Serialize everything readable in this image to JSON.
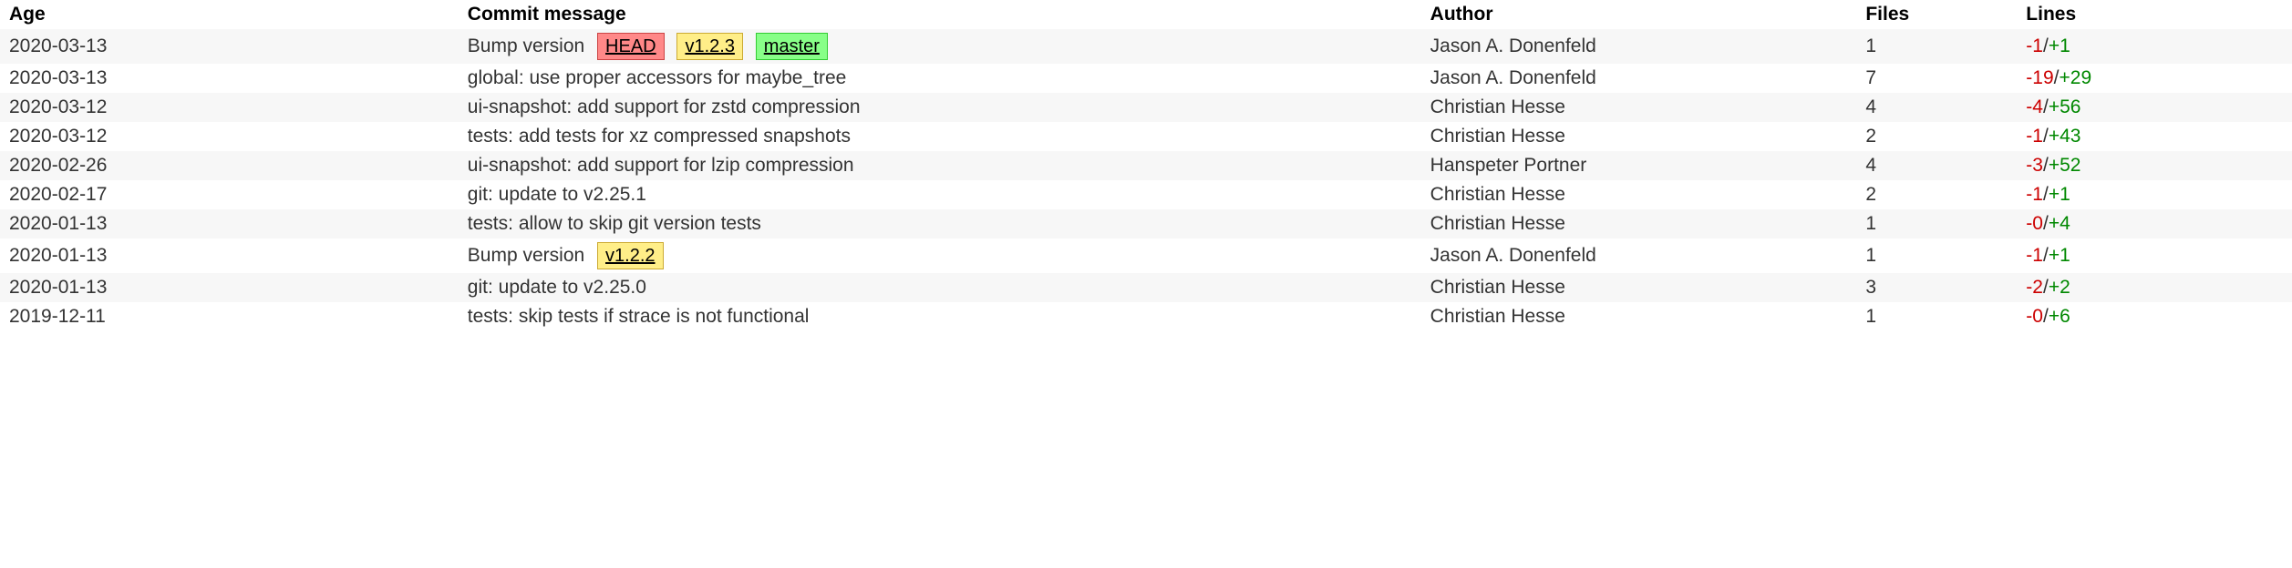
{
  "headers": {
    "age": "Age",
    "message": "Commit message",
    "author": "Author",
    "files": "Files",
    "lines": "Lines"
  },
  "commits": [
    {
      "age": "2020-03-13",
      "message": "Bump version",
      "decorations": [
        {
          "type": "head",
          "label": "HEAD"
        },
        {
          "type": "tag",
          "label": "v1.2.3"
        },
        {
          "type": "branch",
          "label": "master"
        }
      ],
      "author": "Jason A. Donenfeld",
      "files": "1",
      "deletions": "-1",
      "insertions": "+1"
    },
    {
      "age": "2020-03-13",
      "message": "global: use proper accessors for maybe_tree",
      "decorations": [],
      "author": "Jason A. Donenfeld",
      "files": "7",
      "deletions": "-19",
      "insertions": "+29"
    },
    {
      "age": "2020-03-12",
      "message": "ui-snapshot: add support for zstd compression",
      "decorations": [],
      "author": "Christian Hesse",
      "files": "4",
      "deletions": "-4",
      "insertions": "+56"
    },
    {
      "age": "2020-03-12",
      "message": "tests: add tests for xz compressed snapshots",
      "decorations": [],
      "author": "Christian Hesse",
      "files": "2",
      "deletions": "-1",
      "insertions": "+43"
    },
    {
      "age": "2020-02-26",
      "message": "ui-snapshot: add support for lzip compression",
      "decorations": [],
      "author": "Hanspeter Portner",
      "files": "4",
      "deletions": "-3",
      "insertions": "+52"
    },
    {
      "age": "2020-02-17",
      "message": "git: update to v2.25.1",
      "decorations": [],
      "author": "Christian Hesse",
      "files": "2",
      "deletions": "-1",
      "insertions": "+1"
    },
    {
      "age": "2020-01-13",
      "message": "tests: allow to skip git version tests",
      "decorations": [],
      "author": "Christian Hesse",
      "files": "1",
      "deletions": "-0",
      "insertions": "+4"
    },
    {
      "age": "2020-01-13",
      "message": "Bump version",
      "decorations": [
        {
          "type": "tag",
          "label": "v1.2.2"
        }
      ],
      "author": "Jason A. Donenfeld",
      "files": "1",
      "deletions": "-1",
      "insertions": "+1"
    },
    {
      "age": "2020-01-13",
      "message": "git: update to v2.25.0",
      "decorations": [],
      "author": "Christian Hesse",
      "files": "3",
      "deletions": "-2",
      "insertions": "+2"
    },
    {
      "age": "2019-12-11",
      "message": "tests: skip tests if strace is not functional",
      "decorations": [],
      "author": "Christian Hesse",
      "files": "1",
      "deletions": "-0",
      "insertions": "+6"
    }
  ]
}
